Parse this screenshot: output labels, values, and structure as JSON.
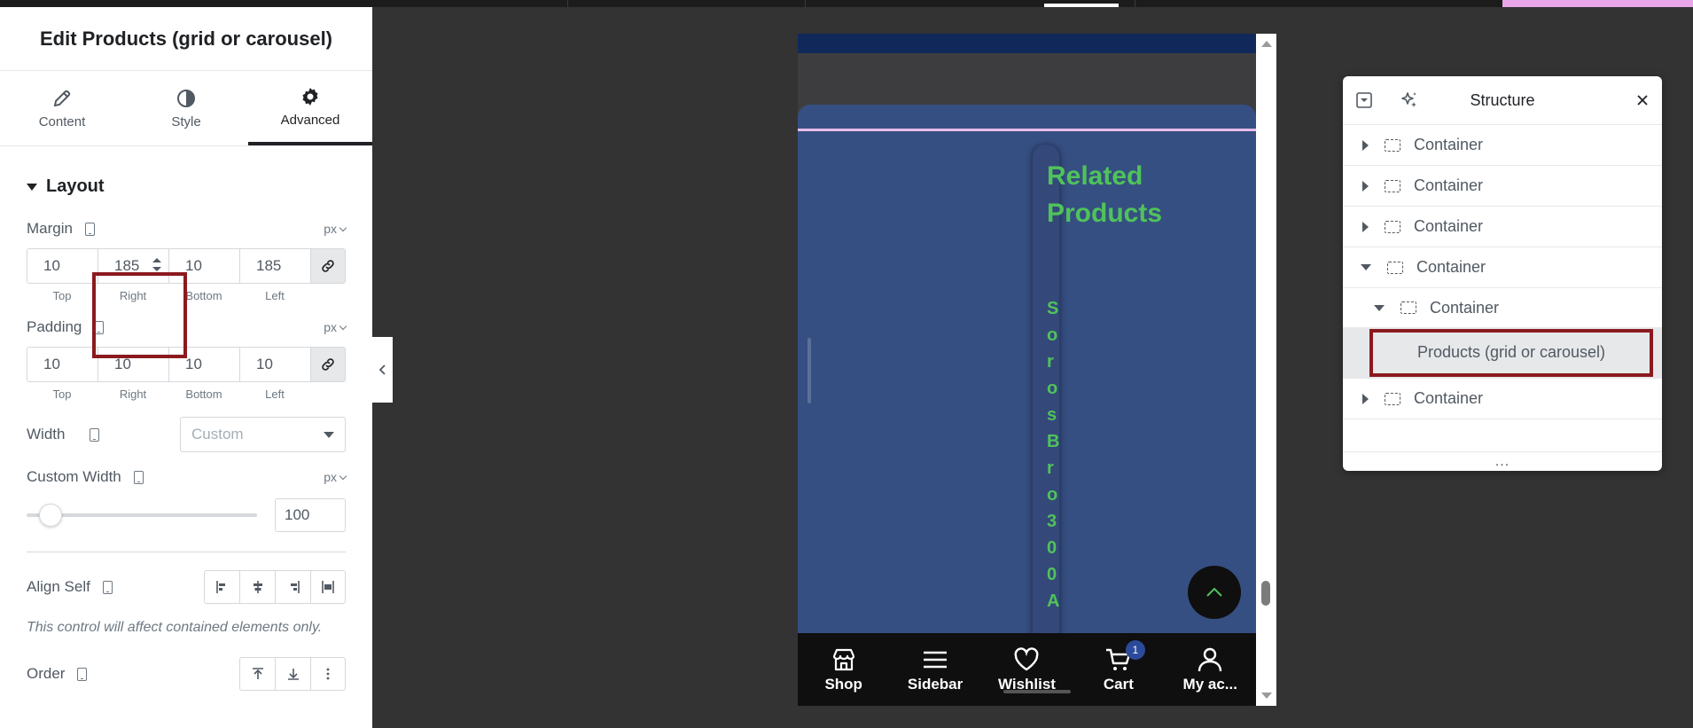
{
  "panel": {
    "title": "Edit Products (grid or carousel)",
    "tabs": [
      {
        "label": "Content",
        "icon": "pencil-icon"
      },
      {
        "label": "Style",
        "icon": "half-circle-icon"
      },
      {
        "label": "Advanced",
        "icon": "gear-icon",
        "active": true
      }
    ],
    "layout": {
      "title": "Layout",
      "margin": {
        "label": "Margin",
        "unit": "px",
        "values": [
          "10",
          "185",
          "10",
          "185"
        ],
        "labels": [
          "Top",
          "Right",
          "Bottom",
          "Left"
        ]
      },
      "padding": {
        "label": "Padding",
        "unit": "px",
        "values": [
          "10",
          "10",
          "10",
          "10"
        ],
        "labels": [
          "Top",
          "Right",
          "Bottom",
          "Left"
        ]
      },
      "width": {
        "label": "Width",
        "placeholder": "Custom"
      },
      "custom_width": {
        "label": "Custom Width",
        "unit": "px",
        "value": "100"
      },
      "align_self": {
        "label": "Align Self",
        "note": "This control will affect contained elements only."
      },
      "order": {
        "label": "Order"
      }
    }
  },
  "preview": {
    "heading": "Related Products",
    "vertical_text": [
      "S",
      "o",
      "r",
      "o",
      "s",
      "B",
      "r",
      "o",
      "3",
      "0",
      "0",
      "A"
    ],
    "nav": [
      {
        "label": "Shop",
        "icon": "shop-icon"
      },
      {
        "label": "Sidebar",
        "icon": "menu-icon"
      },
      {
        "label": "Wishlist",
        "icon": "heart-icon"
      },
      {
        "label": "Cart",
        "icon": "cart-icon",
        "badge": "1"
      },
      {
        "label": "My ac...",
        "icon": "user-icon"
      }
    ],
    "colors": {
      "accent_green": "#4fc35a",
      "card_blue": "#364f82",
      "nav_black": "#0f0f0f"
    }
  },
  "structure": {
    "title": "Structure",
    "items": [
      {
        "label": "Container",
        "expanded": false,
        "level": 0
      },
      {
        "label": "Container",
        "expanded": false,
        "level": 0
      },
      {
        "label": "Container",
        "expanded": false,
        "level": 0
      },
      {
        "label": "Container",
        "expanded": true,
        "level": 0
      },
      {
        "label": "Container",
        "expanded": true,
        "level": 1
      },
      {
        "label": "Products (grid or carousel)",
        "selected": true,
        "level": 2
      },
      {
        "label": "Container",
        "expanded": false,
        "level": 0
      }
    ],
    "footer": "..."
  }
}
